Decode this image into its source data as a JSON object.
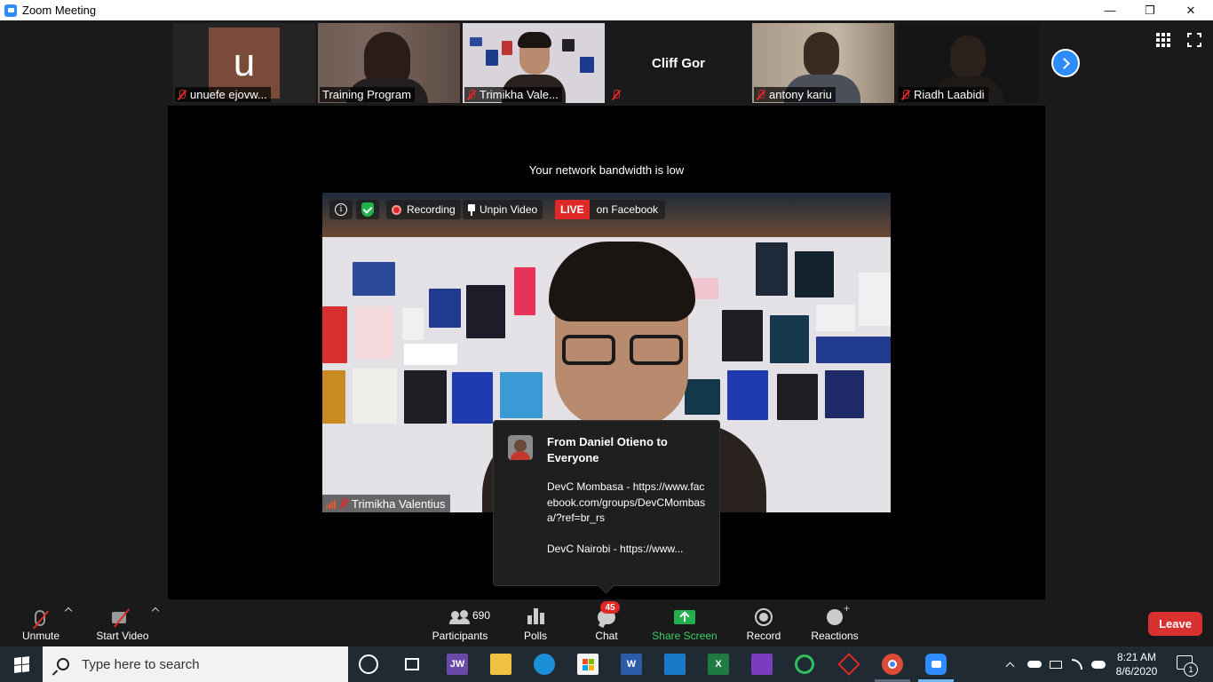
{
  "window": {
    "title": "Zoom Meeting",
    "minimize": "—",
    "restore": "❐",
    "close": "✕"
  },
  "gallery": {
    "tiles": [
      {
        "name": "unuefe ejovw...",
        "avatar_letter": "u",
        "muted": true
      },
      {
        "name": "Training Program",
        "muted": false
      },
      {
        "name": "Trimikha Vale...",
        "muted": true,
        "active": true
      },
      {
        "name": "",
        "display_name": "Cliff Gor",
        "muted": true
      },
      {
        "name": "antony kariu",
        "muted": true
      },
      {
        "name": "Riadh Laabidi",
        "muted": true
      }
    ]
  },
  "stage": {
    "bandwidth_notice": "Your network bandwidth is low",
    "video": {
      "recording_label": "Recording",
      "unpin_label": "Unpin Video",
      "live_label": "LIVE",
      "live_platform": "on Facebook",
      "speaker_name": "Trimikha Valentius"
    }
  },
  "chat_popup": {
    "from": "From Daniel Otieno to Everyone",
    "message": "DevC Mombasa - https://www.facebook.com/groups/DevCMombasa/?ref=br_rs\n\nDevC Nairobi - https://www..."
  },
  "controls": {
    "unmute": "Unmute",
    "start_video": "Start Video",
    "participants_count": "690",
    "participants": "Participants",
    "polls": "Polls",
    "chat": "Chat",
    "chat_badge": "45",
    "share_screen": "Share Screen",
    "record": "Record",
    "reactions": "Reactions",
    "leave": "Leave"
  },
  "taskbar": {
    "search_placeholder": "Type here to search",
    "jw_label": "JW",
    "time": "8:21 AM",
    "date": "8/6/2020",
    "notification_count": "1"
  },
  "colors": {
    "accent": "#2d8cff",
    "live_red": "#e02828",
    "share_green": "#22b14c",
    "leave_red": "#d93030"
  }
}
